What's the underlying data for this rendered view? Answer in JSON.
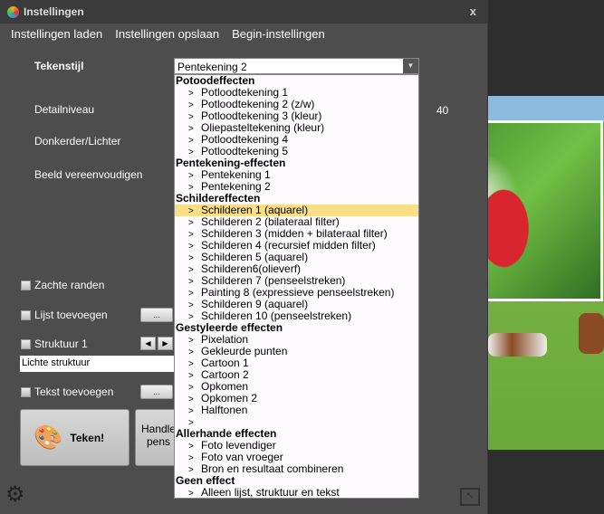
{
  "window": {
    "title": "Instellingen",
    "close": "x"
  },
  "menu": [
    "Instellingen laden",
    "Instellingen opslaan",
    "Begin-instellingen"
  ],
  "labels": {
    "tekenstijl": "Tekenstijl",
    "detail": "Detailniveau",
    "donker": "Donkerder/Lichter",
    "vereenvoudigen": "Beeld vereenvoudigen",
    "detail_value": "40"
  },
  "style_select": {
    "value": "Pentekening 2"
  },
  "dropdown": [
    {
      "t": "h",
      "l": "Potoodeffecten"
    },
    {
      "t": "i",
      "l": "Potloodtekening 1"
    },
    {
      "t": "i",
      "l": "Potloodtekening 2 (z/w)"
    },
    {
      "t": "i",
      "l": "Potloodtekening 3 (kleur)"
    },
    {
      "t": "i",
      "l": "Oliepasteltekening (kleur)"
    },
    {
      "t": "i",
      "l": "Potloodtekening 4"
    },
    {
      "t": "i",
      "l": "Potloodtekening 5"
    },
    {
      "t": "h",
      "l": "Pentekening-effecten"
    },
    {
      "t": "i",
      "l": "Pentekening 1"
    },
    {
      "t": "i",
      "l": "Pentekening 2"
    },
    {
      "t": "h",
      "l": "Schildereffecten"
    },
    {
      "t": "i",
      "l": "Schilderen 1 (aquarel)",
      "sel": true
    },
    {
      "t": "i",
      "l": "Schilderen 2 (bilateraal filter)"
    },
    {
      "t": "i",
      "l": "Schilderen 3 (midden + bilateraal filter)"
    },
    {
      "t": "i",
      "l": "Schilderen 4 (recursief midden filter)"
    },
    {
      "t": "i",
      "l": "Schilderen 5 (aquarel)"
    },
    {
      "t": "i",
      "l": "Schilderen6(olieverf)"
    },
    {
      "t": "i",
      "l": "Schilderen 7 (penseelstreken)"
    },
    {
      "t": "i",
      "l": "Painting 8 (expressieve penseelstreken)"
    },
    {
      "t": "i",
      "l": "Schilderen 9 (aquarel)"
    },
    {
      "t": "i",
      "l": "Schilderen 10 (penseelstreken)"
    },
    {
      "t": "h",
      "l": "Gestyleerde effecten"
    },
    {
      "t": "i",
      "l": "Pixelation"
    },
    {
      "t": "i",
      "l": "Gekleurde punten"
    },
    {
      "t": "i",
      "l": "Cartoon 1"
    },
    {
      "t": "i",
      "l": "Cartoon 2"
    },
    {
      "t": "i",
      "l": "Opkomen"
    },
    {
      "t": "i",
      "l": "Opkomen 2"
    },
    {
      "t": "i",
      "l": "Halftonen"
    },
    {
      "t": "i",
      "l": ""
    },
    {
      "t": "h",
      "l": "Allerhande effecten"
    },
    {
      "t": "i",
      "l": "Foto levendiger"
    },
    {
      "t": "i",
      "l": "Foto van vroeger"
    },
    {
      "t": "i",
      "l": "Bron en resultaat combineren"
    },
    {
      "t": "h",
      "l": "Geen effect"
    },
    {
      "t": "i",
      "l": "Alleen lijst, struktuur en tekst"
    }
  ],
  "bullet": ">",
  "checkboxes": {
    "zacht": "Zachte randen",
    "lijst": "Lijst toevoegen",
    "struktuur": "Struktuur 1",
    "tekst": "Tekst toevoegen"
  },
  "dots": "...",
  "texture_select": {
    "value": "Lichte struktuur"
  },
  "buttons": {
    "teken": "Teken!",
    "handle_1": "Handle",
    "handle_2": "pens"
  }
}
